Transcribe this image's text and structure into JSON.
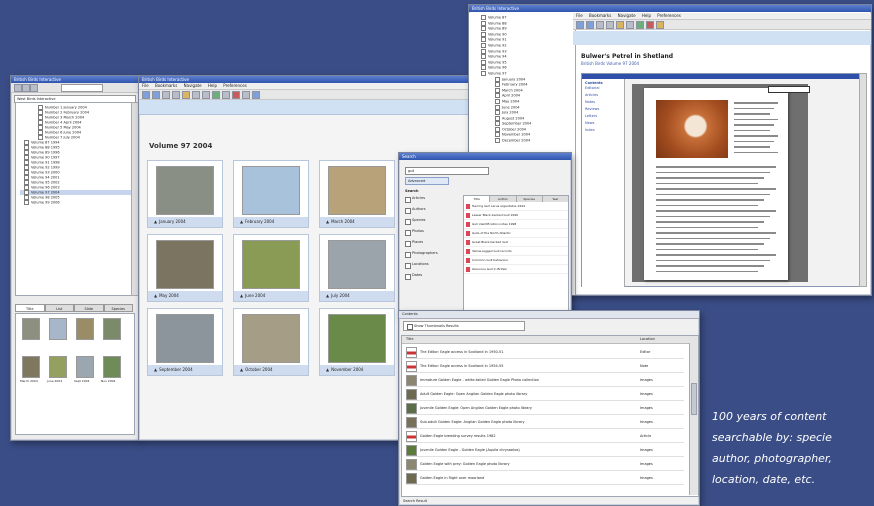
{
  "caption": {
    "line1": "100 years of content",
    "line2": "searchable by: specie",
    "line3": "author, photographer,",
    "line4": "location, date, etc."
  },
  "left_window": {
    "title": "British Birds Interactive",
    "dropdown_value": "West Birds Interactive",
    "tree_items": [
      "Number 1 January 2004",
      "Number 2 February 2004",
      "Number 3 March 2004",
      "Number 4 April 2004",
      "Number 5 May 2004",
      "Number 6 June 2004",
      "Number 7 July 2004",
      "Volume 87 1994",
      "Volume 88 1995",
      "Volume 89 1996",
      "Volume 90 1997",
      "Volume 91 1998",
      "Volume 92 1999",
      "Volume 93 2000",
      "Volume 94 2001",
      "Volume 95 2002",
      "Volume 96 2003",
      "Volume 97 2004",
      "Volume 98 2005",
      "Volume 99 2006"
    ],
    "tabs": [
      "Title",
      "List",
      "Slide",
      "Species"
    ],
    "small_items": [
      "March 2004",
      "June 2004",
      "Sept 2004",
      "Nov 2004"
    ]
  },
  "main_window": {
    "title": "British Birds Interactive",
    "menu": [
      "File",
      "Bookmarks",
      "Navigate",
      "Help",
      "Preferences"
    ],
    "volume_heading": "Volume 97 2004",
    "thumbnails": [
      {
        "label": "January 2004",
        "color": "#8a8f85"
      },
      {
        "label": "February 2004",
        "color": "#a9c2dc"
      },
      {
        "label": "March 2004",
        "color": "#b8a27a"
      },
      {
        "label": "April 2004",
        "color": "#9fb2c4"
      },
      {
        "label": "May 2004",
        "color": "#7a7460"
      },
      {
        "label": "June 2004",
        "color": "#8a9b55"
      },
      {
        "label": "July 2004",
        "color": "#9aa4aa"
      },
      {
        "label": "August 2004",
        "color": "#6d8a59"
      },
      {
        "label": "September 2004",
        "color": "#8c949c"
      },
      {
        "label": "October 2004",
        "color": "#a59d86"
      },
      {
        "label": "November 2004",
        "color": "#6a8a4a"
      }
    ]
  },
  "search_window": {
    "title": "Search",
    "query": "gull",
    "search_button": "Advanced",
    "scope_label": "Search",
    "options": [
      "Articles",
      "Authors",
      "Species",
      "Photos",
      "Places",
      "Photographers",
      "Locations",
      "Dates"
    ],
    "tabs": [
      "Title",
      "Author",
      "Species",
      "Year"
    ],
    "results": [
      "Herring Gull Larus argentatus 1994",
      "Lesser Black-backed Gull 1996",
      "Gull identification notes 1998",
      "Gulls of the North Atlantic",
      "Great Black-backed Gull",
      "Yellow-legged Gull records",
      "Common Gull behaviour",
      "Glaucous Gull in Britain"
    ]
  },
  "content_panel": {
    "title": "Contents",
    "filter_label": "Show Thumbnails Results",
    "columns": [
      "Title",
      "Location"
    ],
    "rows": [
      {
        "title": "The Editor: Eagle access in Scotland in 1950-51",
        "loc": "Editor",
        "kind": "pdf"
      },
      {
        "title": "The Editor: Eagle access in Scotland in 1954-55",
        "loc": "Note",
        "kind": "pdf"
      },
      {
        "title": "Immature Golden Eagle - white-tailed Golden Eagle Photo collection",
        "loc": "Images",
        "kind": "photo"
      },
      {
        "title": "Adult Golden Eagle: Open Anglian Golden Eagle photo library",
        "loc": "Images",
        "kind": "photo"
      },
      {
        "title": "Juvenile Golden Eagle: Open Anglian Golden Eagle photo library",
        "loc": "Images",
        "kind": "photo"
      },
      {
        "title": "Sub-adult Golden Eagle: Anglian Golden Eagle photo library",
        "loc": "Images",
        "kind": "photo"
      },
      {
        "title": "Golden Eagle breeding survey results 1982",
        "loc": "Article",
        "kind": "pdf"
      },
      {
        "title": "Juvenile Golden Eagle - Golden Eagle (Aquila chrysaetos)",
        "loc": "Images",
        "kind": "photo"
      },
      {
        "title": "Golden Eagle with prey: Golden Eagle photo library",
        "loc": "Images",
        "kind": "photo"
      },
      {
        "title": "Golden Eagle in flight over moorland",
        "loc": "Images",
        "kind": "photo"
      }
    ],
    "status": "Search Result"
  },
  "article_window": {
    "title": "British Birds Interactive",
    "menu": [
      "File",
      "Bookmarks",
      "Navigate",
      "Help",
      "Preferences"
    ],
    "heading": "Bulwer's Petrel in Shetland",
    "subheading": "British Birds Volume 97 2004",
    "sidebar_title": "Contents",
    "sidebar_items": [
      "Editorial",
      "Articles",
      "Notes",
      "Reviews",
      "Letters",
      "News",
      "Index"
    ],
    "tree_items": [
      "Volume 87",
      "Volume 88",
      "Volume 89",
      "Volume 90",
      "Volume 91",
      "Volume 92",
      "Volume 93",
      "Volume 94",
      "Volume 95",
      "Volume 96",
      "Volume 97",
      "January 2004",
      "February 2004",
      "March 2004",
      "April 2004",
      "May 2004",
      "June 2004",
      "July 2004",
      "August 2004",
      "September 2004",
      "October 2004",
      "November 2004",
      "December 2004"
    ]
  }
}
